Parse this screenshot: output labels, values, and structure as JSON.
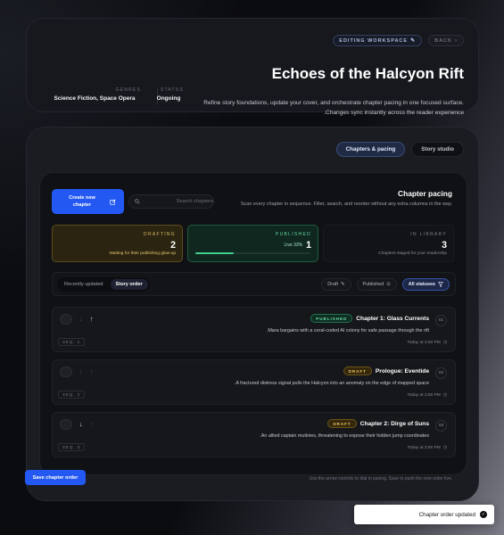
{
  "header": {
    "workspace_pill": "EDITING WORKSPACE",
    "back_pill": "BACK",
    "title": "Echoes of the Halcyon Rift",
    "description": "Refine story foundations, update your cover, and orchestrate chapter pacing in one focused surface. Changes sync instantly across the reader experience.",
    "genres_label": "GENRES",
    "genres_value": "Science Fiction, Space Opera",
    "status_label": "STATUS",
    "status_value": "Ongoing"
  },
  "tabs": [
    {
      "label": "Chapters & pacing",
      "active": true
    },
    {
      "label": "Story studio",
      "active": false
    }
  ],
  "pacing": {
    "create_button": "Create new chapter",
    "search_placeholder": "Search chapters",
    "title": "Chapter pacing",
    "description": "Scan every chapter in sequence. Filter, search, and reorder without any extra columns in the way."
  },
  "stats": {
    "drafting": {
      "label": "DRAFTING",
      "count": "2",
      "note": "Waiting for their publishing glow-up"
    },
    "published": {
      "label": "PUBLISHED",
      "count": "1",
      "percent": "Live 33%",
      "progress_fraction": 0.33
    },
    "library": {
      "label": "IN LIBRARY",
      "count": "3",
      "note": "Chapters staged for your readership"
    }
  },
  "sort": {
    "recent": "Recently updated",
    "story_order": "Story order"
  },
  "filters": {
    "draft": "Draft",
    "published": "Published",
    "all": "All statuses"
  },
  "chapters": [
    {
      "status": "PUBLISHED",
      "title": "Chapter 1: Glass Currents",
      "num": "01",
      "desc": "Mara bargains with a coral-coded AI colony for safe passage through the rift.",
      "time": "Today at 3:50 PM",
      "seq": "SEQ. 1"
    },
    {
      "status": "DRAFT",
      "title": "Prologue: Eventide",
      "num": "02",
      "desc": "A fractured distress signal pulls the Halcyon into an anomaly on the edge of mapped space.",
      "time": "Today at 3:50 PM",
      "seq": "SEQ. 2"
    },
    {
      "status": "DRAFT",
      "title": "Chapter 2: Dirge of Suns",
      "num": "03",
      "desc": "An allied captain mutinies, threatening to expose their hidden jump coordinates.",
      "time": "Today at 3:50 PM",
      "seq": "SEQ. 3"
    }
  ],
  "footer": {
    "save_button": "Save chapter order",
    "hint": "Use the arrow controls to dial in pacing. Save to push the new order live."
  },
  "toast": {
    "message": "Chapter order updated"
  },
  "colors": {
    "accent": "#2358f2",
    "published": "#3fcf8e",
    "draft": "#f0c660"
  }
}
